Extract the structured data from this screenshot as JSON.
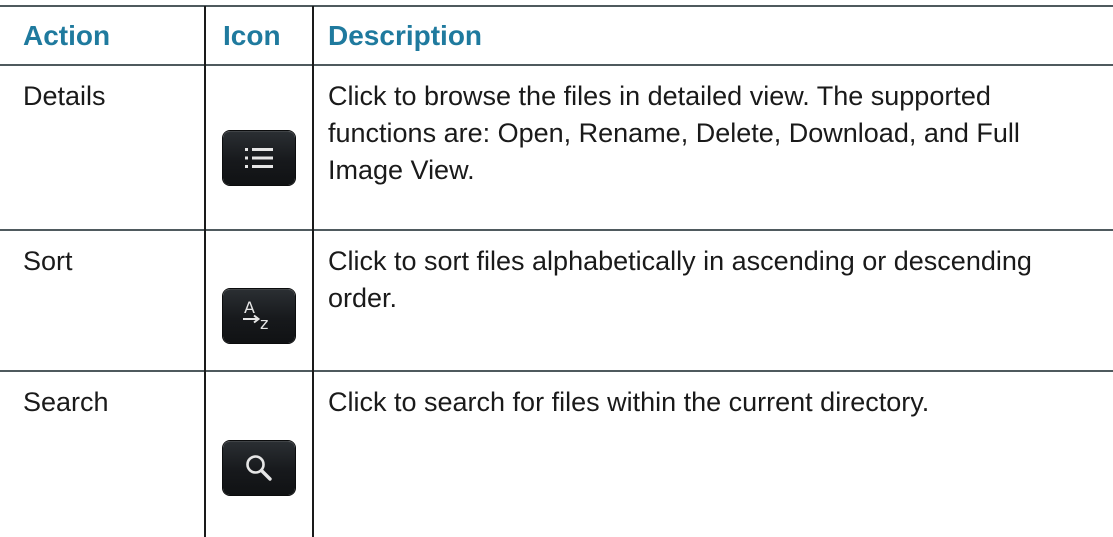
{
  "table": {
    "headers": {
      "action": "Action",
      "icon": "Icon",
      "description": "Description"
    },
    "rows": [
      {
        "action": "Details",
        "icon": "list-icon",
        "description": "Click to browse the files in detailed view. The supported functions are: Open, Rename, Delete, Download, and Full Image View."
      },
      {
        "action": "Sort",
        "icon": "sort-az-icon",
        "description": "Click to sort files alphabetically in ascending or descending order."
      },
      {
        "action": "Search",
        "icon": "search-icon",
        "description": "Click to search for files within the current directory."
      }
    ]
  },
  "colors": {
    "header_text": "#1f7a9e",
    "rule": "#4f5a5e",
    "icon_background": "#17191c",
    "icon_glyph": "#e6e6e6"
  }
}
